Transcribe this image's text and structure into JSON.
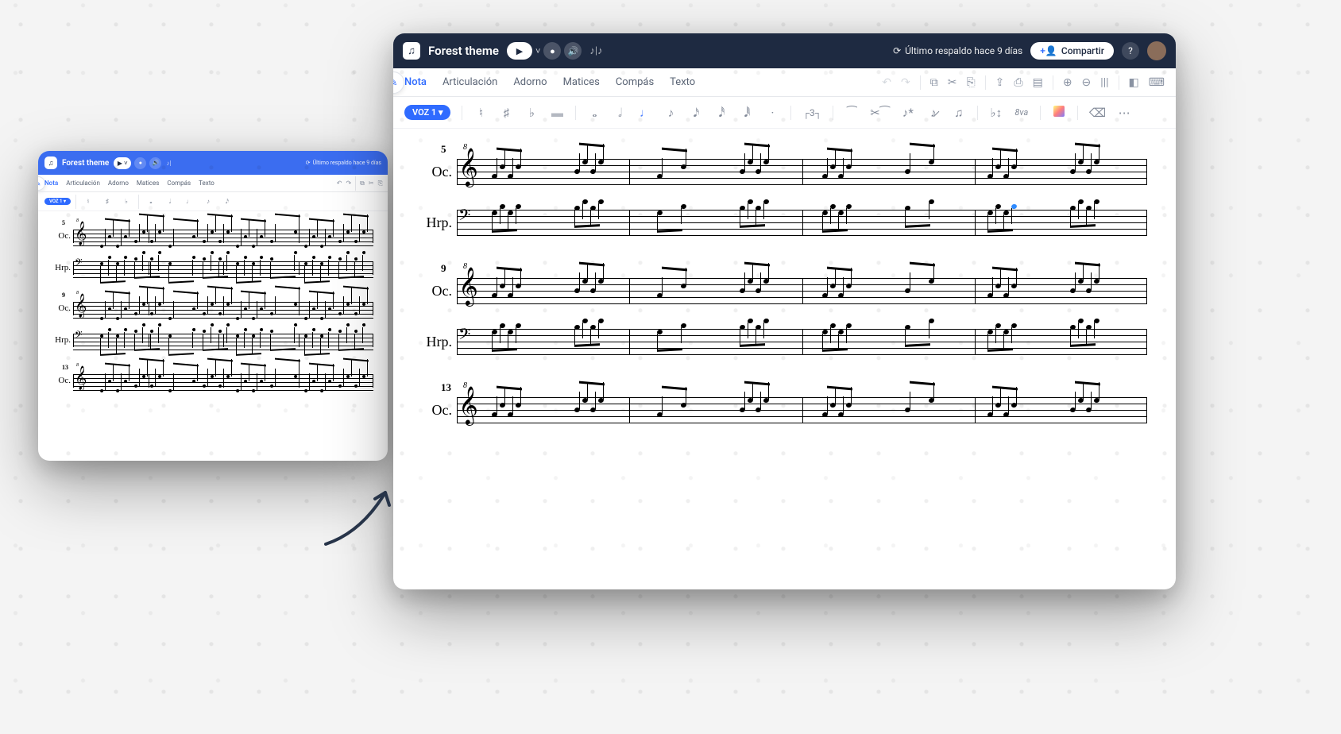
{
  "app": {
    "title": "Forest theme"
  },
  "header": {
    "backup_label": "Último respaldo hace 9 días",
    "share_label": "Compartir"
  },
  "tabs": {
    "nota": "Nota",
    "articulacion": "Articulación",
    "adorno": "Adorno",
    "matices": "Matices",
    "compas": "Compás",
    "texto": "Texto"
  },
  "tools": {
    "voice_label": "VOZ 1 ▾",
    "octave": "8va"
  },
  "score": {
    "systems": [
      {
        "measure": "5",
        "staves": [
          "Oc.",
          "Hrp."
        ]
      },
      {
        "measure": "9",
        "staves": [
          "Oc.",
          "Hrp."
        ]
      },
      {
        "measure": "13",
        "staves": [
          "Oc."
        ]
      }
    ]
  }
}
